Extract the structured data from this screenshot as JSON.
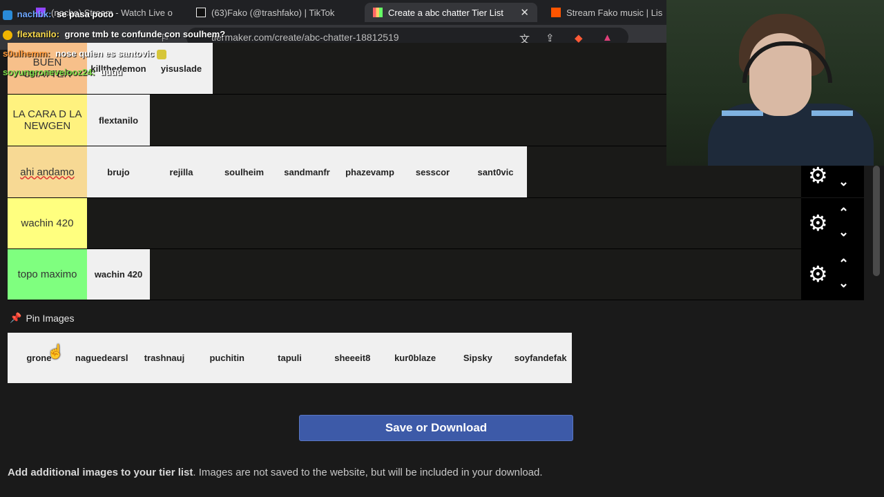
{
  "browser": {
    "tabs": [
      {
        "title": "(nacho) Stream - Watch Live on"
      },
      {
        "title": "(63)Fako (@trashfako) | TikTok"
      },
      {
        "title": "Create a abc chatter Tier List"
      },
      {
        "title": "Stream Fako music | Lis"
      }
    ],
    "url": "tiermaker.com/create/abc-chatter-18812519"
  },
  "tiers": [
    {
      "label": "BUEN CHATTER",
      "color": "#f7c08a",
      "items": [
        "killthedemon",
        "yisuslade"
      ]
    },
    {
      "label": "LA CARA D LA NEWGEN",
      "color": "#fff27f",
      "items": [
        "flextanilo"
      ]
    },
    {
      "label": "ahi andamo",
      "color": "#f7d994",
      "items": [
        "brujo",
        "rejilla",
        "soulheim",
        "sandmanfr",
        "phazevamp",
        "sesscor",
        "sant0vic"
      ]
    },
    {
      "label": "wachin 420",
      "color": "#ffff7f",
      "items": []
    },
    {
      "label": "topo maximo",
      "color": "#7fff7f",
      "items": [
        "wachin 420"
      ]
    }
  ],
  "pin": {
    "header": "Pin Images",
    "items": [
      "grone",
      "naguedearsl",
      "trashnauj",
      "puchitin",
      "tapuli",
      "sheeeit8",
      "kur0blaze",
      "Sipsky",
      "soyfandefak"
    ]
  },
  "save_button": "Save or Download",
  "add_text": {
    "bold": "Add additional images to your tier list",
    "rest": ". Images are not saved to the website, but will be included in your download."
  },
  "chat": [
    {
      "user": "nachbk:",
      "msg": "se pasa poco",
      "color": "#6fa8ff"
    },
    {
      "user": "flextanilo:",
      "msg": "grone tmb te confunde con soulhem?",
      "color": "#f7d84a"
    },
    {
      "user": "s0ulhemm:",
      "msg": "nose quien es santovic",
      "color": "#ff9a3c"
    },
    {
      "user": "soyungroneveiooz24:",
      "msg": "uuuu",
      "color": "#7ddc4a"
    }
  ]
}
